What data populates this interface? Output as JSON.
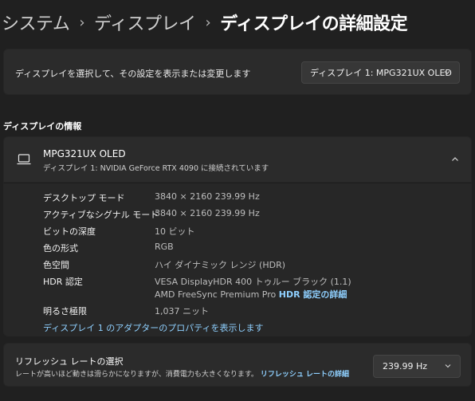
{
  "breadcrumb": {
    "items": [
      "システム",
      "ディスプレイ",
      "ディスプレイの詳細設定"
    ],
    "separator": "›"
  },
  "display_select": {
    "label": "ディスプレイを選択して、その設定を表示または変更します",
    "selected": "ディスプレイ 1: MPG321UX OLED"
  },
  "section_title": "ディスプレイの情報",
  "display_info": {
    "name": "MPG321UX OLED",
    "subtitle": "ディスプレイ 1: NVIDIA GeForce RTX 4090 に接続されています",
    "rows": [
      {
        "key": "デスクトップ モード",
        "value": "3840 × 2160 239.99 Hz"
      },
      {
        "key": "アクティブなシグナル モード",
        "value": "3840 × 2160 239.99 Hz"
      },
      {
        "key": "ビットの深度",
        "value": "10 ビット"
      },
      {
        "key": "色の形式",
        "value": "RGB"
      },
      {
        "key": "色空間",
        "value": "ハイ ダイナミック レンジ (HDR)"
      }
    ],
    "hdr": {
      "key": "HDR 認定",
      "line1": "VESA DisplayHDR 400 トゥルー ブラック (1.1)",
      "line2": "AMD FreeSync Premium Pro",
      "link": "HDR 認定の詳細"
    },
    "brightness": {
      "key": "明るさ極限",
      "value": "1,037 ニット"
    },
    "adapter_link": "ディスプレイ 1 のアダプターのプロパティを表示します"
  },
  "refresh_rate": {
    "title": "リフレッシュ レートの選択",
    "description": "レートが高いほど動きは滑らかになりますが、消費電力も大きくなります。",
    "link": "リフレッシュ レートの詳細",
    "selected": "239.99 Hz"
  },
  "colors": {
    "background": "#202020",
    "card": "#2b2b2b",
    "link": "#8fd0ff"
  }
}
